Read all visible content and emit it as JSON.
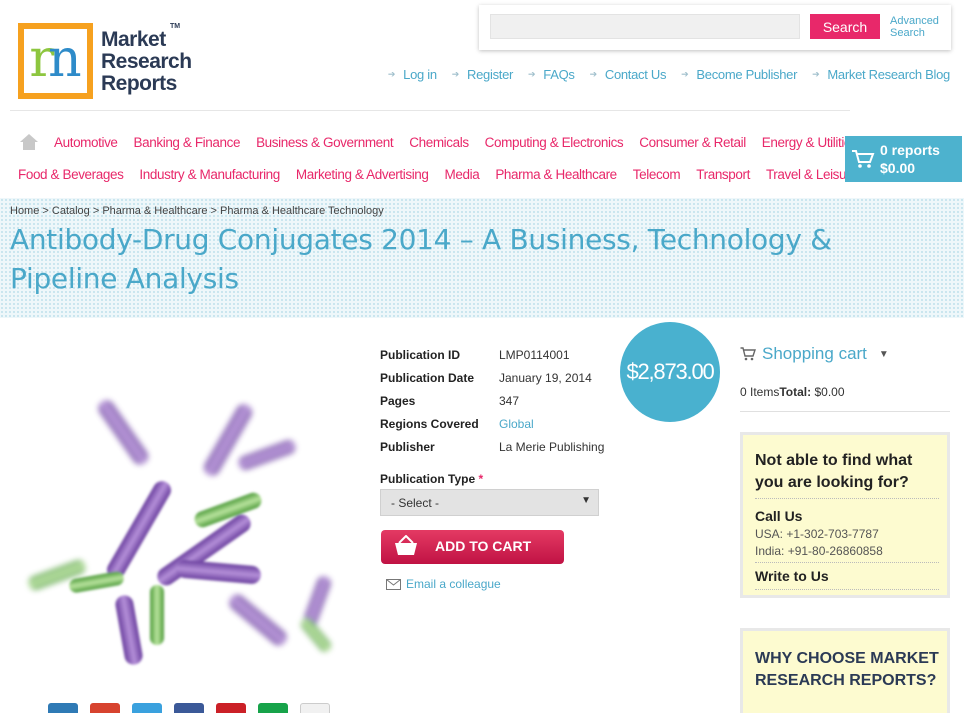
{
  "brand": {
    "logo_letter": "m",
    "name_lines": [
      "Market",
      "Research",
      "Reports"
    ],
    "tm": "TM"
  },
  "search": {
    "placeholder": "",
    "button_label": "Search",
    "advanced_label": "Advanced Search"
  },
  "top_links": [
    "Log in",
    "Register",
    "FAQs",
    "Contact Us",
    "Become Publisher",
    "Market Research Blog"
  ],
  "categories_row1": [
    "Automotive",
    "Banking & Finance",
    "Business & Government",
    "Chemicals",
    "Computing & Electronics",
    "Consumer & Retail",
    "Energy & Utilities"
  ],
  "categories_row2": [
    "Food & Beverages",
    "Industry & Manufacturing",
    "Marketing & Advertising",
    "Media",
    "Pharma & Healthcare",
    "Telecom",
    "Transport",
    "Travel & Leisure"
  ],
  "header_cart": {
    "reports": "0 reports",
    "total": "$0.00"
  },
  "breadcrumb": "Home > Catalog > Pharma & Healthcare > Pharma & Healthcare Technology",
  "page_title": "Antibody-Drug Conjugates 2014 – A Business, Technology & Pipeline Analysis",
  "details": [
    {
      "label": "Publication ID",
      "value": "LMP0114001"
    },
    {
      "label": "Publication Date",
      "value": "January 19, 2014"
    },
    {
      "label": "Pages",
      "value": "347"
    },
    {
      "label": "Regions Covered",
      "value": "Global"
    },
    {
      "label": "Publisher",
      "value": "La Merie Publishing"
    }
  ],
  "price": "$2,873.00",
  "publication_type": {
    "label": "Publication Type",
    "required_mark": "*",
    "selected": "- Select -"
  },
  "add_to_cart_label": "ADD TO CART",
  "email_colleague_label": "Email a colleague",
  "sidebar": {
    "shopping_cart_title": "Shopping cart",
    "items_label": "0 Items",
    "total_label": "Total:",
    "total_value": "$0.00",
    "help_question": "Not able to find what you are looking for?",
    "call_us": "Call Us",
    "usa_phone": "USA: +1-302-703-7787",
    "india_phone": "India: +91-80-26860858",
    "write_to_us": "Write to Us",
    "why_choose": "WHY CHOOSE MARKET RESEARCH REPORTS?"
  },
  "colors": {
    "accent_pink": "#e8286a",
    "accent_blue": "#4aa8c9",
    "price_circle": "#49b1cf",
    "help_box_bg": "#fdfbd0"
  },
  "icons": [
    "home-icon",
    "cart-icon",
    "basket-icon",
    "envelope-icon",
    "arrow-icon",
    "chevron-down-icon"
  ]
}
